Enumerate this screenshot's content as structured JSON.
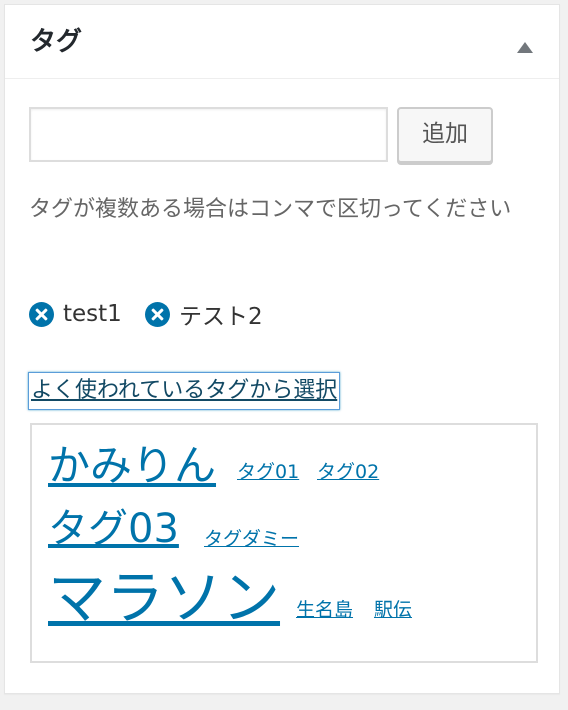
{
  "metabox": {
    "title": "タグ",
    "toggle_icon": "triangle-up-icon"
  },
  "input": {
    "value": "",
    "placeholder": ""
  },
  "add_button_label": "追加",
  "howto_text": "タグが複数ある場合はコンマで区切ってください",
  "tags": [
    {
      "label": "test1",
      "icon": "remove-circle-icon"
    },
    {
      "label": "テスト2",
      "icon": "remove-circle-icon"
    }
  ],
  "choose_link_label": "よく使われているタグから選択",
  "tag_cloud": [
    {
      "label": "かみりん",
      "size": "large"
    },
    {
      "label": "タグ01",
      "size": "small"
    },
    {
      "label": "タグ02",
      "size": "small"
    },
    {
      "label": "タグ03",
      "size": "large"
    },
    {
      "label": "タグダミー",
      "size": "small"
    },
    {
      "label": "マラソン",
      "size": "xlarge"
    },
    {
      "label": "生名島",
      "size": "small"
    },
    {
      "label": "駅伝",
      "size": "small"
    }
  ],
  "colors": {
    "link": "#0073aa",
    "remove_icon": "#0073aa",
    "focus_border": "#5b9dd9"
  }
}
